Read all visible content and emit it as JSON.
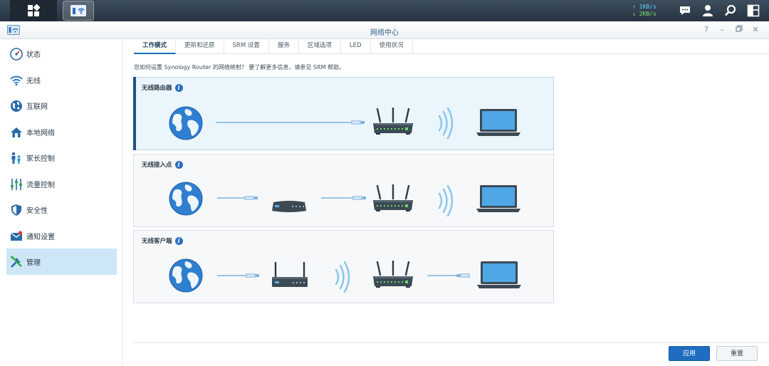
{
  "taskbar": {
    "net_up": "1KB/s",
    "net_down": "2KB/s",
    "icons": [
      "main-menu-icon",
      "network-center-app-icon",
      "chat-icon",
      "user-icon",
      "search-icon",
      "widgets-icon"
    ]
  },
  "window": {
    "title": "网络中心",
    "controls": [
      "help-icon",
      "minimize-icon",
      "restore-icon",
      "close-icon"
    ]
  },
  "sidebar": {
    "items": [
      {
        "label": "状态",
        "icon": "speedometer-icon"
      },
      {
        "label": "无线",
        "icon": "wifi-icon"
      },
      {
        "label": "互联网",
        "icon": "globe-icon"
      },
      {
        "label": "本地网络",
        "icon": "home-network-icon"
      },
      {
        "label": "家长控制",
        "icon": "family-icon"
      },
      {
        "label": "流量控制",
        "icon": "sliders-icon"
      },
      {
        "label": "安全性",
        "icon": "shield-icon"
      },
      {
        "label": "通知设置",
        "icon": "notification-icon"
      },
      {
        "label": "管理",
        "icon": "tools-icon",
        "active": true
      }
    ]
  },
  "tabs": [
    {
      "label": "工作模式",
      "active": true
    },
    {
      "label": "更新和还原"
    },
    {
      "label": "SRM 设置"
    },
    {
      "label": "服务"
    },
    {
      "label": "区域选项"
    },
    {
      "label": "LED"
    },
    {
      "label": "使用状况"
    }
  ],
  "description": "您如何设置 Synology Router 的网络映射？ 要了解更多信息，请参见 SRM 帮助。",
  "modes": [
    {
      "title": "无线路由器",
      "selected": true
    },
    {
      "title": "无线接入点",
      "selected": false
    },
    {
      "title": "无线客户端",
      "selected": false
    }
  ],
  "footer": {
    "apply_label": "应用",
    "reset_label": "重置"
  },
  "colors": {
    "accent": "#1f6dc0",
    "selected_bg": "#eaf5fc",
    "taskbar": "#2c3a47"
  }
}
